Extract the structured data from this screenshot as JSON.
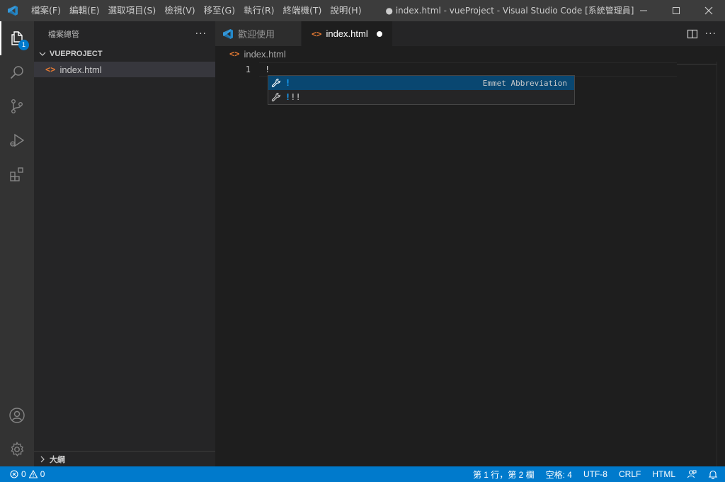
{
  "titlebar": {
    "menu": [
      "檔案(F)",
      "編輯(E)",
      "選取項目(S)",
      "檢視(V)",
      "移至(G)",
      "執行(R)",
      "終端機(T)",
      "說明(H)"
    ],
    "window_title": "● index.html - vueProject - Visual Studio Code [系統管理員]"
  },
  "activitybar": {
    "explorer_badge": "1"
  },
  "sidebar": {
    "title": "檔案總管",
    "more": "···",
    "folder": "VUEPROJECT",
    "files": [
      {
        "name": "index.html"
      }
    ],
    "outline": "大綱"
  },
  "tabs": [
    {
      "label": "歡迎使用"
    },
    {
      "label": "index.html"
    }
  ],
  "tab_actions": {
    "more": "···"
  },
  "breadcrumb": {
    "file": "index.html"
  },
  "editor": {
    "line_number": "1",
    "code": "!"
  },
  "suggest": {
    "items": [
      {
        "match": "!",
        "rest": "",
        "detail": "Emmet Abbreviation"
      },
      {
        "match": "!",
        "rest": "!!",
        "detail": ""
      }
    ]
  },
  "statusbar": {
    "errors": "0",
    "warnings": "0",
    "position": "第 1 行，第 2 欄",
    "spaces": "空格: 4",
    "encoding": "UTF-8",
    "eol": "CRLF",
    "language": "HTML"
  },
  "colors": {
    "accent": "#007acc",
    "html_icon": "#e37933",
    "suggest_selected": "#094771",
    "match": "#18a3ff"
  }
}
